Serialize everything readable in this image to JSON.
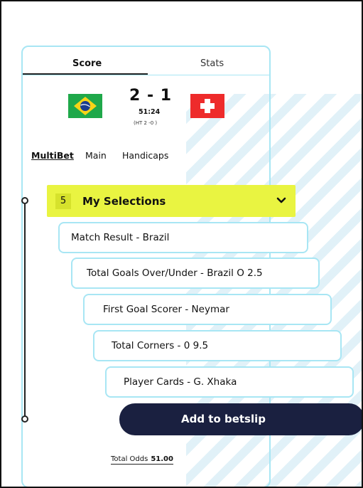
{
  "tabs": {
    "score": "Score",
    "stats": "Stats"
  },
  "match": {
    "home_flag": "brazil-flag-icon",
    "away_flag": "switzerland-flag-icon",
    "score": "2 - 1",
    "clock": "51:24",
    "half_time": "(HT 2 -0 )"
  },
  "market_tabs": [
    "MultiBet",
    "Main",
    "Handicaps"
  ],
  "selections_header": {
    "count": "5",
    "title": "My Selections"
  },
  "selections": [
    "Match Result - Brazil",
    "Total Goals Over/Under - Brazil O 2.5",
    "First Goal Scorer - Neymar",
    "Total Corners - 0 9.5",
    "Player Cards - G. Xhaka"
  ],
  "cta": {
    "label": "Add to betslip"
  },
  "total_odds": {
    "label": "Total Odds",
    "value": "51.00"
  },
  "colors": {
    "accent": "#e9f441",
    "border": "#a8e6f4",
    "button": "#1a2040",
    "swiss_red": "#ee2b2b",
    "brazil_green": "#1fa84a"
  }
}
